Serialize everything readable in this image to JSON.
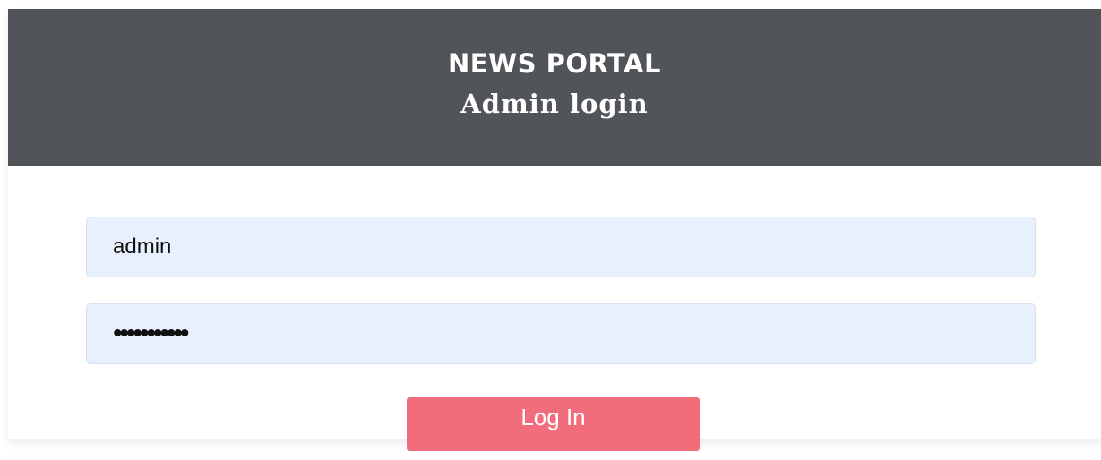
{
  "header": {
    "brand": "NEWS PORTAL",
    "subtitle": "Admin login"
  },
  "form": {
    "username_value": "admin",
    "password_value": "•••••••••••",
    "login_label": "Log In"
  },
  "colors": {
    "header_bg": "#515458",
    "input_bg": "#e8f0fe",
    "button_bg": "#f26d7b"
  }
}
